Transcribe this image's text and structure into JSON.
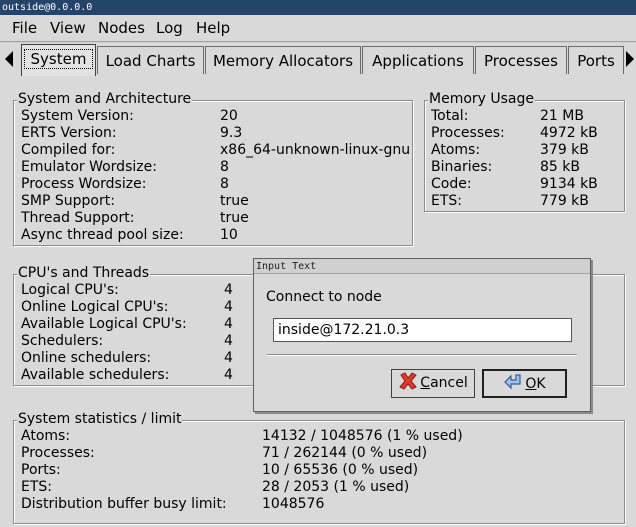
{
  "window": {
    "title": "outside@0.0.0.0"
  },
  "menubar": {
    "items": [
      "File",
      "View",
      "Nodes",
      "Log",
      "Help"
    ]
  },
  "tabs": [
    "System",
    "Load Charts",
    "Memory Allocators",
    "Applications",
    "Processes",
    "Ports"
  ],
  "system_arch": {
    "title": "System and Architecture",
    "rows": [
      {
        "label": "System Version:",
        "value": "20"
      },
      {
        "label": "ERTS Version:",
        "value": "9.3"
      },
      {
        "label": "Compiled for:",
        "value": "x86_64-unknown-linux-gnu"
      },
      {
        "label": "Emulator Wordsize:",
        "value": "8"
      },
      {
        "label": "Process Wordsize:",
        "value": "8"
      },
      {
        "label": "SMP Support:",
        "value": "true"
      },
      {
        "label": "Thread Support:",
        "value": "true"
      },
      {
        "label": "Async thread pool size:",
        "value": "10"
      }
    ]
  },
  "memory": {
    "title": "Memory Usage",
    "rows": [
      {
        "label": "Total:",
        "value": "21 MB"
      },
      {
        "label": "Processes:",
        "value": "4972 kB"
      },
      {
        "label": "Atoms:",
        "value": "379 kB"
      },
      {
        "label": "Binaries:",
        "value": "85 kB"
      },
      {
        "label": "Code:",
        "value": "9134 kB"
      },
      {
        "label": "ETS:",
        "value": "779 kB"
      }
    ]
  },
  "cpu": {
    "title": "CPU's and Threads",
    "rows": [
      {
        "label": "Logical CPU's:",
        "value": "4"
      },
      {
        "label": "Online Logical CPU's:",
        "value": "4"
      },
      {
        "label": "Available Logical CPU's:",
        "value": "4"
      },
      {
        "label": "Schedulers:",
        "value": "4"
      },
      {
        "label": "Online schedulers:",
        "value": "4"
      },
      {
        "label": "Available schedulers:",
        "value": "4"
      }
    ]
  },
  "stats": {
    "title": "System statistics / limit",
    "rows": [
      {
        "label": "Atoms:",
        "value": "14132 / 1048576 (1 % used)"
      },
      {
        "label": "Processes:",
        "value": "71 / 262144 (0 % used)"
      },
      {
        "label": "Ports:",
        "value": "10 / 65536 (0 % used)"
      },
      {
        "label": "ETS:",
        "value": "28 / 2053 (1 % used)"
      },
      {
        "label": "Distribution buffer busy limit:",
        "value": "1048576"
      }
    ]
  },
  "dialog": {
    "title": "Input Text",
    "prompt": "Connect to node",
    "input_value": "inside@172.21.0.3",
    "cancel_first": "C",
    "cancel_rest": "ancel",
    "ok_first": "O",
    "ok_rest": "K"
  },
  "colors": {
    "titlebar": "#24456b",
    "background": "#d9d9d9"
  }
}
